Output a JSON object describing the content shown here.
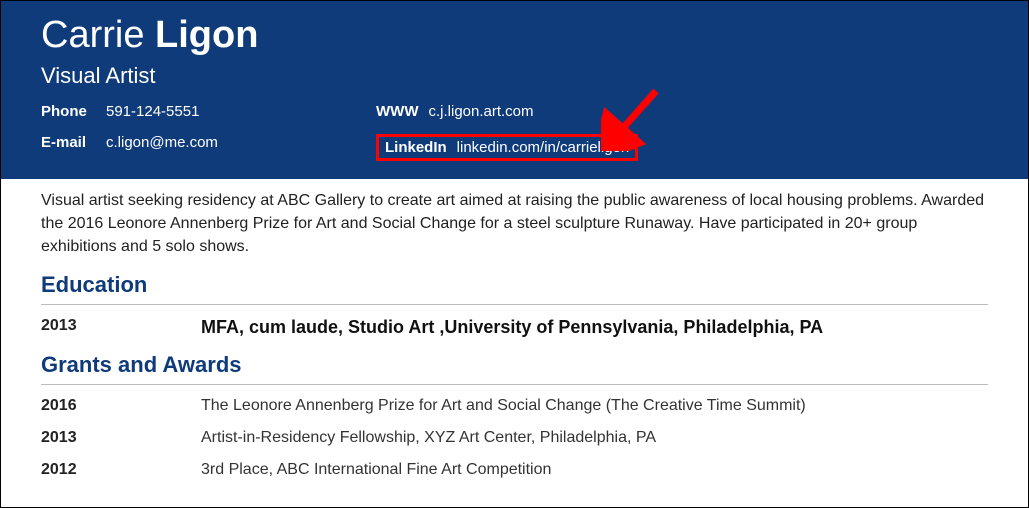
{
  "header": {
    "first_name": "Carrie",
    "last_name": "Ligon",
    "role": "Visual Artist",
    "contacts": {
      "phone_label": "Phone",
      "phone": "591-124-5551",
      "email_label": "E-mail",
      "email": "c.ligon@me.com",
      "www_label": "WWW",
      "www": "c.j.ligon.art.com",
      "linkedin_label": "LinkedIn",
      "linkedin": "linkedin.com/in/carrieligon"
    }
  },
  "summary": "Visual artist seeking residency at ABC Gallery to create art aimed at raising the public awareness of local housing problems. Awarded the 2016 Leonore Annenberg Prize for Art and Social Change for a steel sculpture Runaway. Have participated in 20+ group exhibitions and 5 solo shows.",
  "sections": {
    "education_title": "Education",
    "grants_title": "Grants and Awards"
  },
  "education": [
    {
      "year": "2013",
      "detail": "MFA, cum laude, Studio Art ,University of Pennsylvania, Philadelphia, PA"
    }
  ],
  "grants": [
    {
      "year": "2016",
      "detail": "The Leonore Annenberg Prize for Art and Social Change (The Creative Time Summit)"
    },
    {
      "year": "2013",
      "detail": "Artist-in-Residency Fellowship, XYZ Art Center, Philadelphia, PA"
    },
    {
      "year": "2012",
      "detail": "3rd Place, ABC International Fine Art Competition"
    }
  ],
  "annotation": {
    "highlight_color": "#ff0000"
  }
}
